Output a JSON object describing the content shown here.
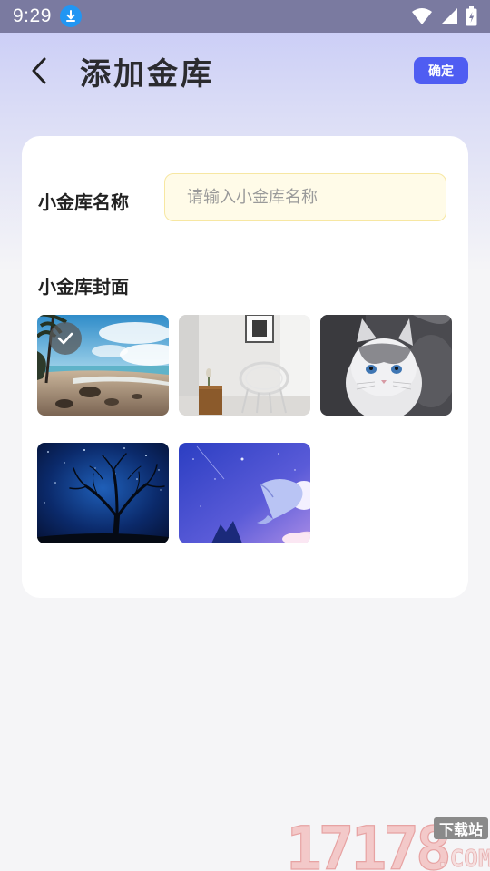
{
  "status_bar": {
    "time": "9:29",
    "icons": [
      "download-icon",
      "wifi-icon",
      "signal-icon",
      "battery-icon"
    ]
  },
  "header": {
    "title": "添加金库",
    "confirm_label": "确定",
    "back_icon": "chevron-left-icon"
  },
  "form": {
    "name_label": "小金库名称",
    "name_value": "",
    "name_placeholder": "请输入小金库名称",
    "cover_label": "小金库封面"
  },
  "covers": [
    {
      "subject": "beach",
      "selected": true
    },
    {
      "subject": "white chair",
      "selected": false
    },
    {
      "subject": "cat",
      "selected": false
    },
    {
      "subject": "night tree",
      "selected": false
    },
    {
      "subject": "whale sky",
      "selected": false
    }
  ],
  "watermark": {
    "number": "17178",
    "tag": "下载站",
    "domain": ".COM"
  },
  "colors": {
    "accent": "#4f5df2",
    "input_bg": "#fffbe8",
    "input_border": "#f7e7a2",
    "status_bar": "#7a7aa0"
  }
}
